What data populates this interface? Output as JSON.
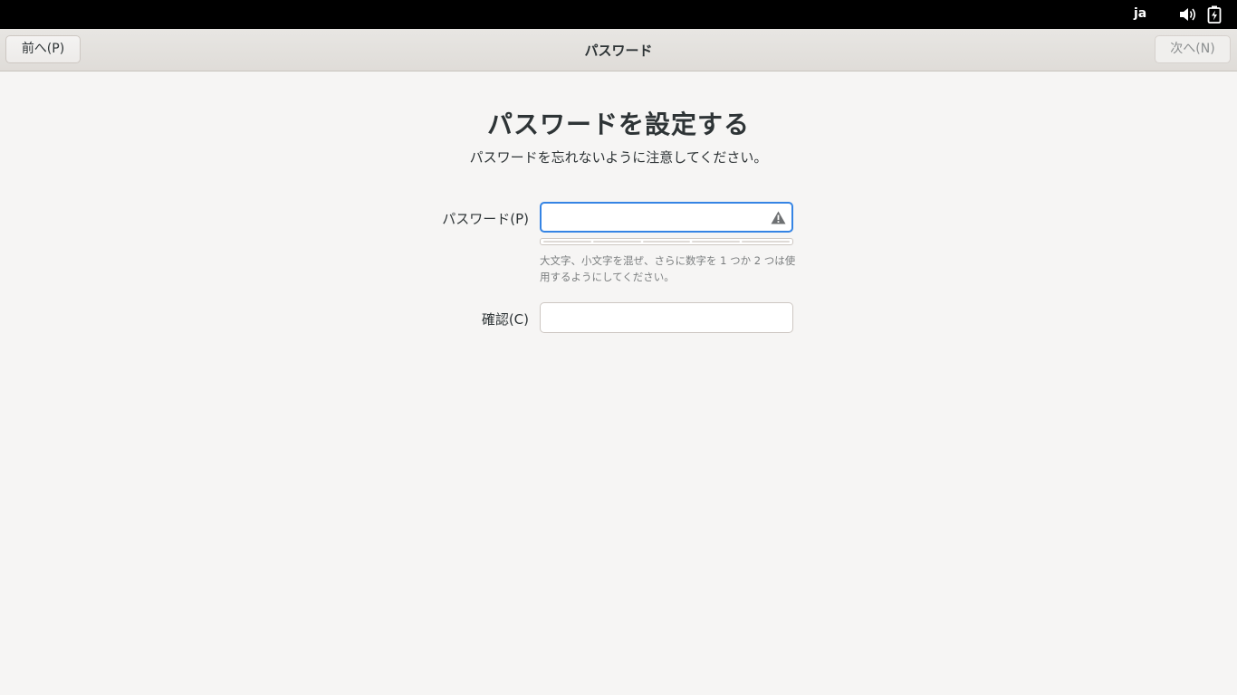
{
  "topbar": {
    "language": "ja",
    "icons": [
      "volume-icon",
      "battery-charging-icon"
    ]
  },
  "header": {
    "prev_label": "前へ(P)",
    "title": "パスワード",
    "next_label": "次へ(N)"
  },
  "main": {
    "title": "パスワードを設定する",
    "subtitle": "パスワードを忘れないように注意してください。",
    "password_label": "パスワード(P)",
    "password_value": "",
    "password_status_icon": "warning-icon",
    "strength_segments": 5,
    "strength_level": 0,
    "hint": "大文字、小文字を混ぜ、さらに数字を 1 つか 2 つは使用するようにしてください。",
    "confirm_label": "確認(C)",
    "confirm_value": ""
  },
  "colors": {
    "focus_accent": "#3584e4",
    "background": "#f6f5f4",
    "topbar": "#000000"
  }
}
